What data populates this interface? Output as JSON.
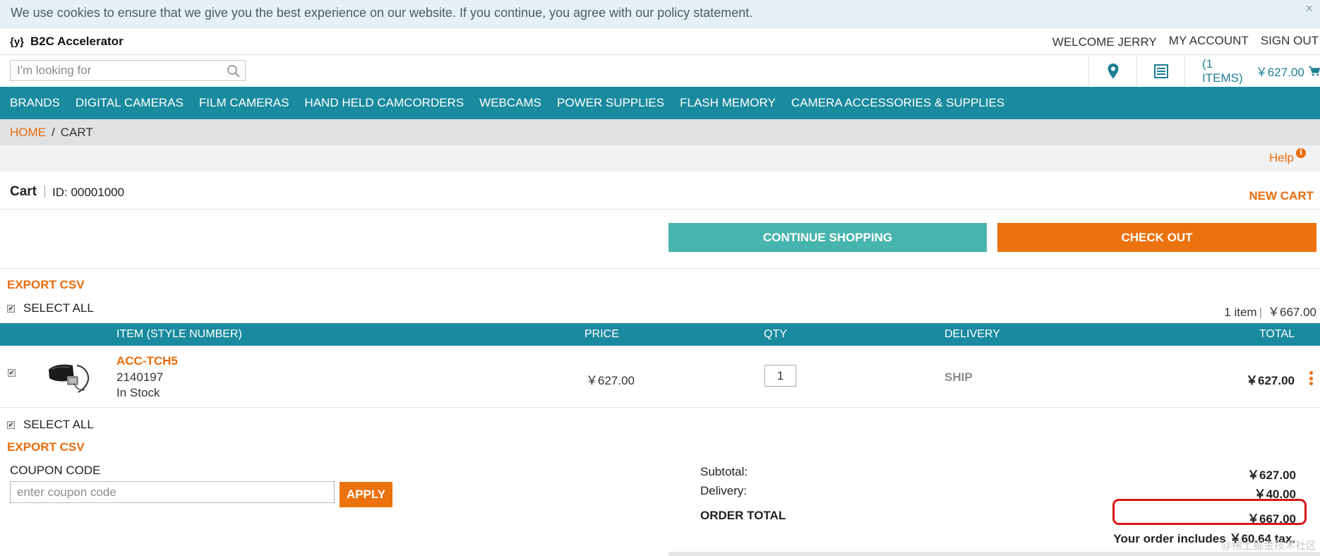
{
  "cookie_bar": {
    "message": "We use cookies to ensure that we give you the best experience on our website. If you continue, you agree with our policy statement.",
    "close": "×"
  },
  "header": {
    "logo_mark": "{y}",
    "brand": "B2C Accelerator",
    "welcome": "WELCOME JERRY",
    "my_account": "MY ACCOUNT",
    "sign_out": "SIGN OUT"
  },
  "search": {
    "placeholder": "I'm looking for"
  },
  "minicart": {
    "items": "(1 ITEMS)",
    "total": "￥627.00"
  },
  "nav": {
    "items": [
      "BRANDS",
      "DIGITAL CAMERAS",
      "FILM CAMERAS",
      "HAND HELD CAMCORDERS",
      "WEBCAMS",
      "POWER SUPPLIES",
      "FLASH MEMORY",
      "CAMERA ACCESSORIES & SUPPLIES"
    ]
  },
  "breadcrumb": {
    "home": "HOME",
    "sep": "/",
    "current": "CART"
  },
  "help": {
    "label": "Help",
    "icon": "i"
  },
  "cart": {
    "title": "Cart",
    "id_label": "ID: 00001000",
    "new_cart": "NEW CART",
    "continue_shopping": "CONTINUE SHOPPING",
    "check_out": "CHECK OUT",
    "export_csv": "EXPORT CSV",
    "select_all": "SELECT ALL",
    "item_count": "1 item",
    "item_total": "￥667.00"
  },
  "table": {
    "headers": {
      "item": "ITEM (STYLE NUMBER)",
      "price": "PRICE",
      "qty": "QTY",
      "delivery": "DELIVERY",
      "total": "TOTAL"
    },
    "rows": [
      {
        "code": "ACC-TCH5",
        "sku": "2140197",
        "stock": "In Stock",
        "price": "￥627.00",
        "qty": "1",
        "delivery": "SHIP",
        "total": "￥627.00"
      }
    ]
  },
  "coupon": {
    "label": "COUPON CODE",
    "placeholder": "enter coupon code",
    "apply": "APPLY"
  },
  "totals": {
    "subtotal_label": "Subtotal:",
    "subtotal": "￥627.00",
    "delivery_label": "Delivery:",
    "delivery": "￥40.00",
    "order_total_label": "ORDER TOTAL",
    "order_total": "￥667.00",
    "tax_note": "Your order includes ￥60.64 tax."
  },
  "watermark": "@稀土掘金技术社区",
  "colors": {
    "teal": "#1a8a9e",
    "orange": "#e86c0c",
    "continue_btn": "#48b4ae",
    "highlight": "#d71616"
  },
  "icons": [
    "search-icon",
    "location-pin-icon",
    "list-icon",
    "cart-icon",
    "info-icon",
    "kebab-icon"
  ]
}
